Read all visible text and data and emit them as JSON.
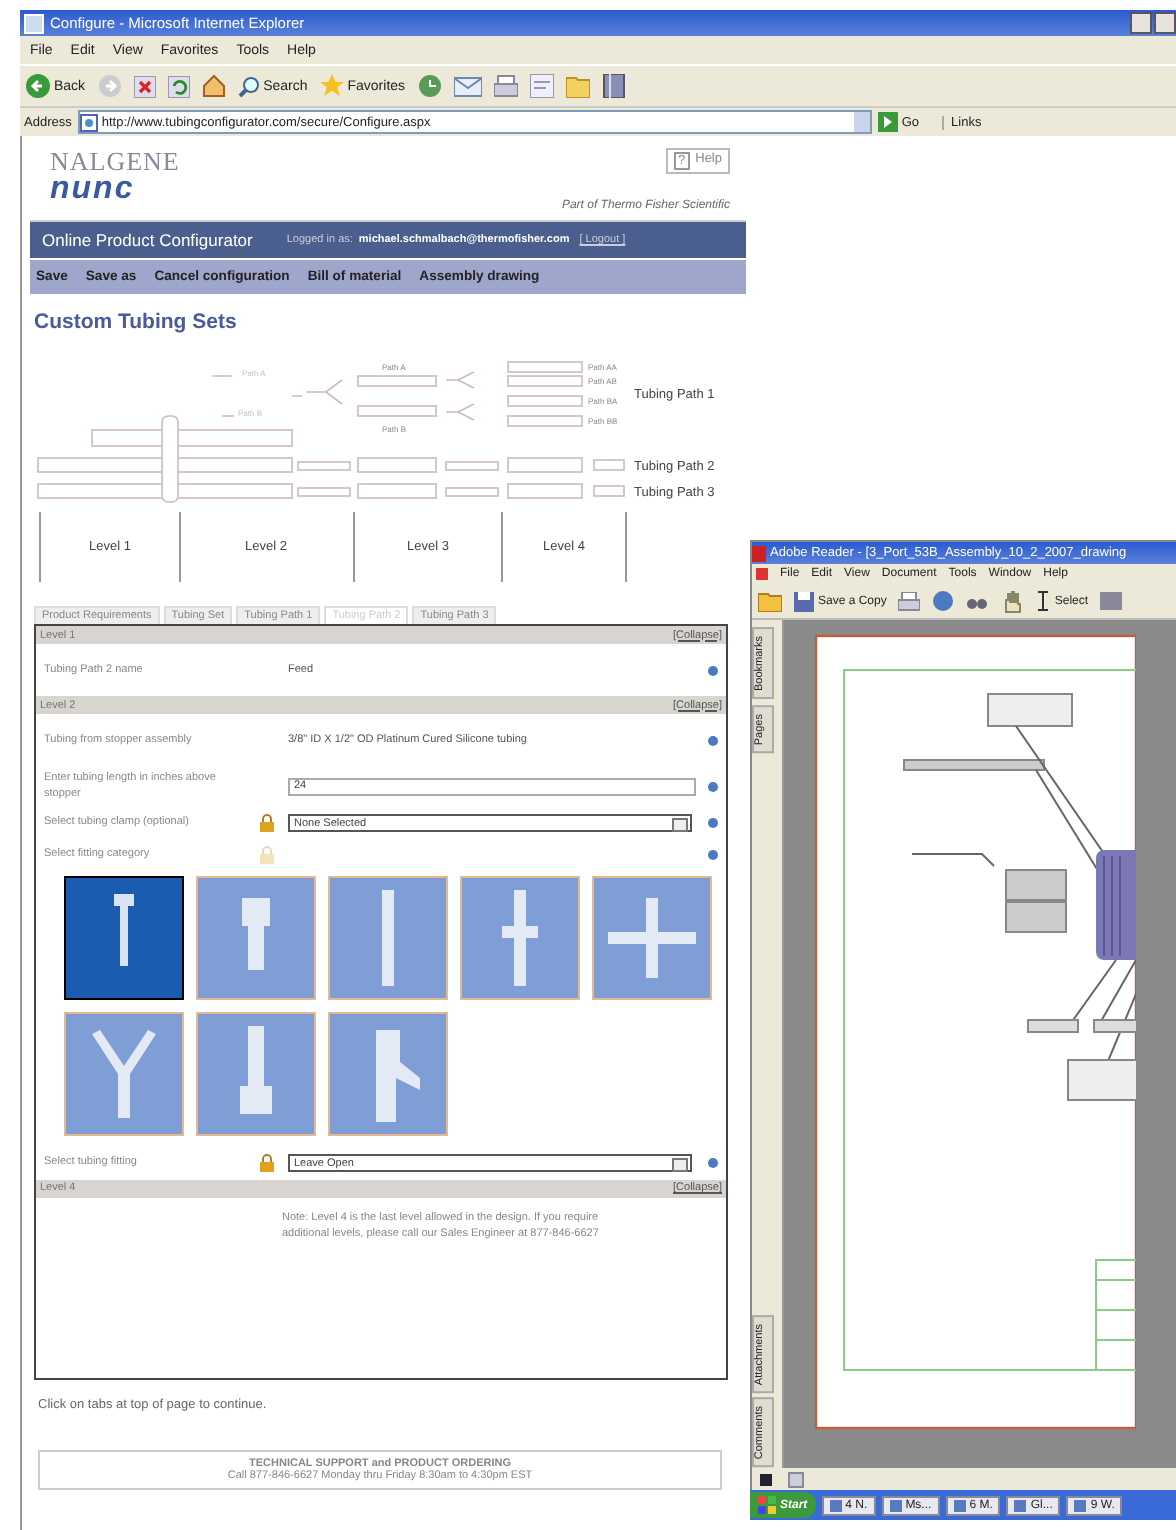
{
  "browser": {
    "title": "Configure - Microsoft Internet Explorer",
    "menu": [
      "File",
      "Edit",
      "View",
      "Favorites",
      "Tools",
      "Help"
    ],
    "toolbar": {
      "back": "Back",
      "search": "Search",
      "favorites": "Favorites"
    },
    "address": {
      "label": "Address",
      "url": "http://www.tubingconfigurator.com/secure/Configure.aspx",
      "go": "Go",
      "links": "Links"
    }
  },
  "header": {
    "logo_top": "NALGENE",
    "logo_bottom": "nunc",
    "help_glyph": "?",
    "help": "Help",
    "tagline": "Part of Thermo Fisher Scientific"
  },
  "banner": {
    "title": "Online Product Configurator",
    "logged_in_label": "Logged in as:",
    "email": "michael.schmalbach@thermofisher.com",
    "logout": "[ Logout ]"
  },
  "actions": [
    "Save",
    "Save as",
    "Cancel configuration",
    "Bill of material",
    "Assembly drawing"
  ],
  "heading": "Custom Tubing Sets",
  "diagram": {
    "stub_labels": [
      "Path A",
      "Path B"
    ],
    "branch_labels": [
      "Path A",
      "Path B"
    ],
    "sub_labels": [
      "Path AA",
      "Path AB",
      "Path BA",
      "Path BB"
    ],
    "paths": [
      "Tubing Path 1",
      "Tubing Path 2",
      "Tubing Path 3"
    ],
    "levels": [
      "Level 1",
      "Level 2",
      "Level 3",
      "Level 4"
    ]
  },
  "tabs": [
    {
      "label": "Product Requirements",
      "selected": false
    },
    {
      "label": "Tubing Set",
      "selected": false
    },
    {
      "label": "Tubing Path 1",
      "selected": false
    },
    {
      "label": "Tubing Path 2",
      "selected": true
    },
    {
      "label": "Tubing Path 3",
      "selected": false
    }
  ],
  "sections": [
    {
      "title": "Level 1",
      "action": "[Collapse]",
      "rows": [
        {
          "kind": "text",
          "label": "Tubing Path 2 name",
          "value": "Feed"
        }
      ]
    },
    {
      "title": "Level 2",
      "action": "[Collapse]",
      "rows": [
        {
          "kind": "text",
          "label": "Tubing from stopper assembly",
          "value": "3/8\" ID X 1/2\" OD Platinum Cured Silicone tubing"
        },
        {
          "kind": "input",
          "label": "Enter tubing length in inches above stopper",
          "value": "24"
        },
        {
          "kind": "select",
          "label": "Select tubing clamp (optional)",
          "value": "None Selected",
          "locked": true
        },
        {
          "kind": "choices",
          "label": "Select fitting category",
          "locked": false,
          "options": [
            {
              "selected": true
            },
            {
              "selected": false
            },
            {
              "selected": false
            },
            {
              "selected": false
            },
            {
              "selected": false
            },
            {
              "selected": false
            },
            {
              "selected": false
            },
            {
              "selected": false
            }
          ]
        },
        {
          "kind": "select",
          "label": "Select tubing fitting",
          "value": "Leave Open",
          "locked": true
        }
      ]
    },
    {
      "title": "Level 4",
      "action": "[Collapse]",
      "rows": [
        {
          "kind": "note",
          "value": "Note: Level 4 is the last level allowed in the design. If you require additional levels, please call our Sales Engineer at 877-846-6627"
        }
      ]
    }
  ],
  "hint": "Click on tabs at top of page to continue.",
  "footer": {
    "title": "TECHNICAL SUPPORT and PRODUCT ORDERING",
    "line": "Call 877-846-6627 Monday thru Friday 8:30am to 4:30pm EST"
  },
  "reader": {
    "title": "Adobe Reader - [3_Port_53B_Assembly_10_2_2007_drawing",
    "menu": [
      "File",
      "Edit",
      "View",
      "Document",
      "Tools",
      "Window",
      "Help"
    ],
    "save_copy": "Save a Copy",
    "select": "Select",
    "side_tabs_top": [
      "Bookmarks",
      "Pages"
    ],
    "side_tabs_bottom": [
      "Attachments",
      "Comments"
    ]
  },
  "taskbar": {
    "start": "Start",
    "items": [
      "4 N.",
      "Ms...",
      "6 M.",
      "Gl...",
      "9 W."
    ]
  }
}
